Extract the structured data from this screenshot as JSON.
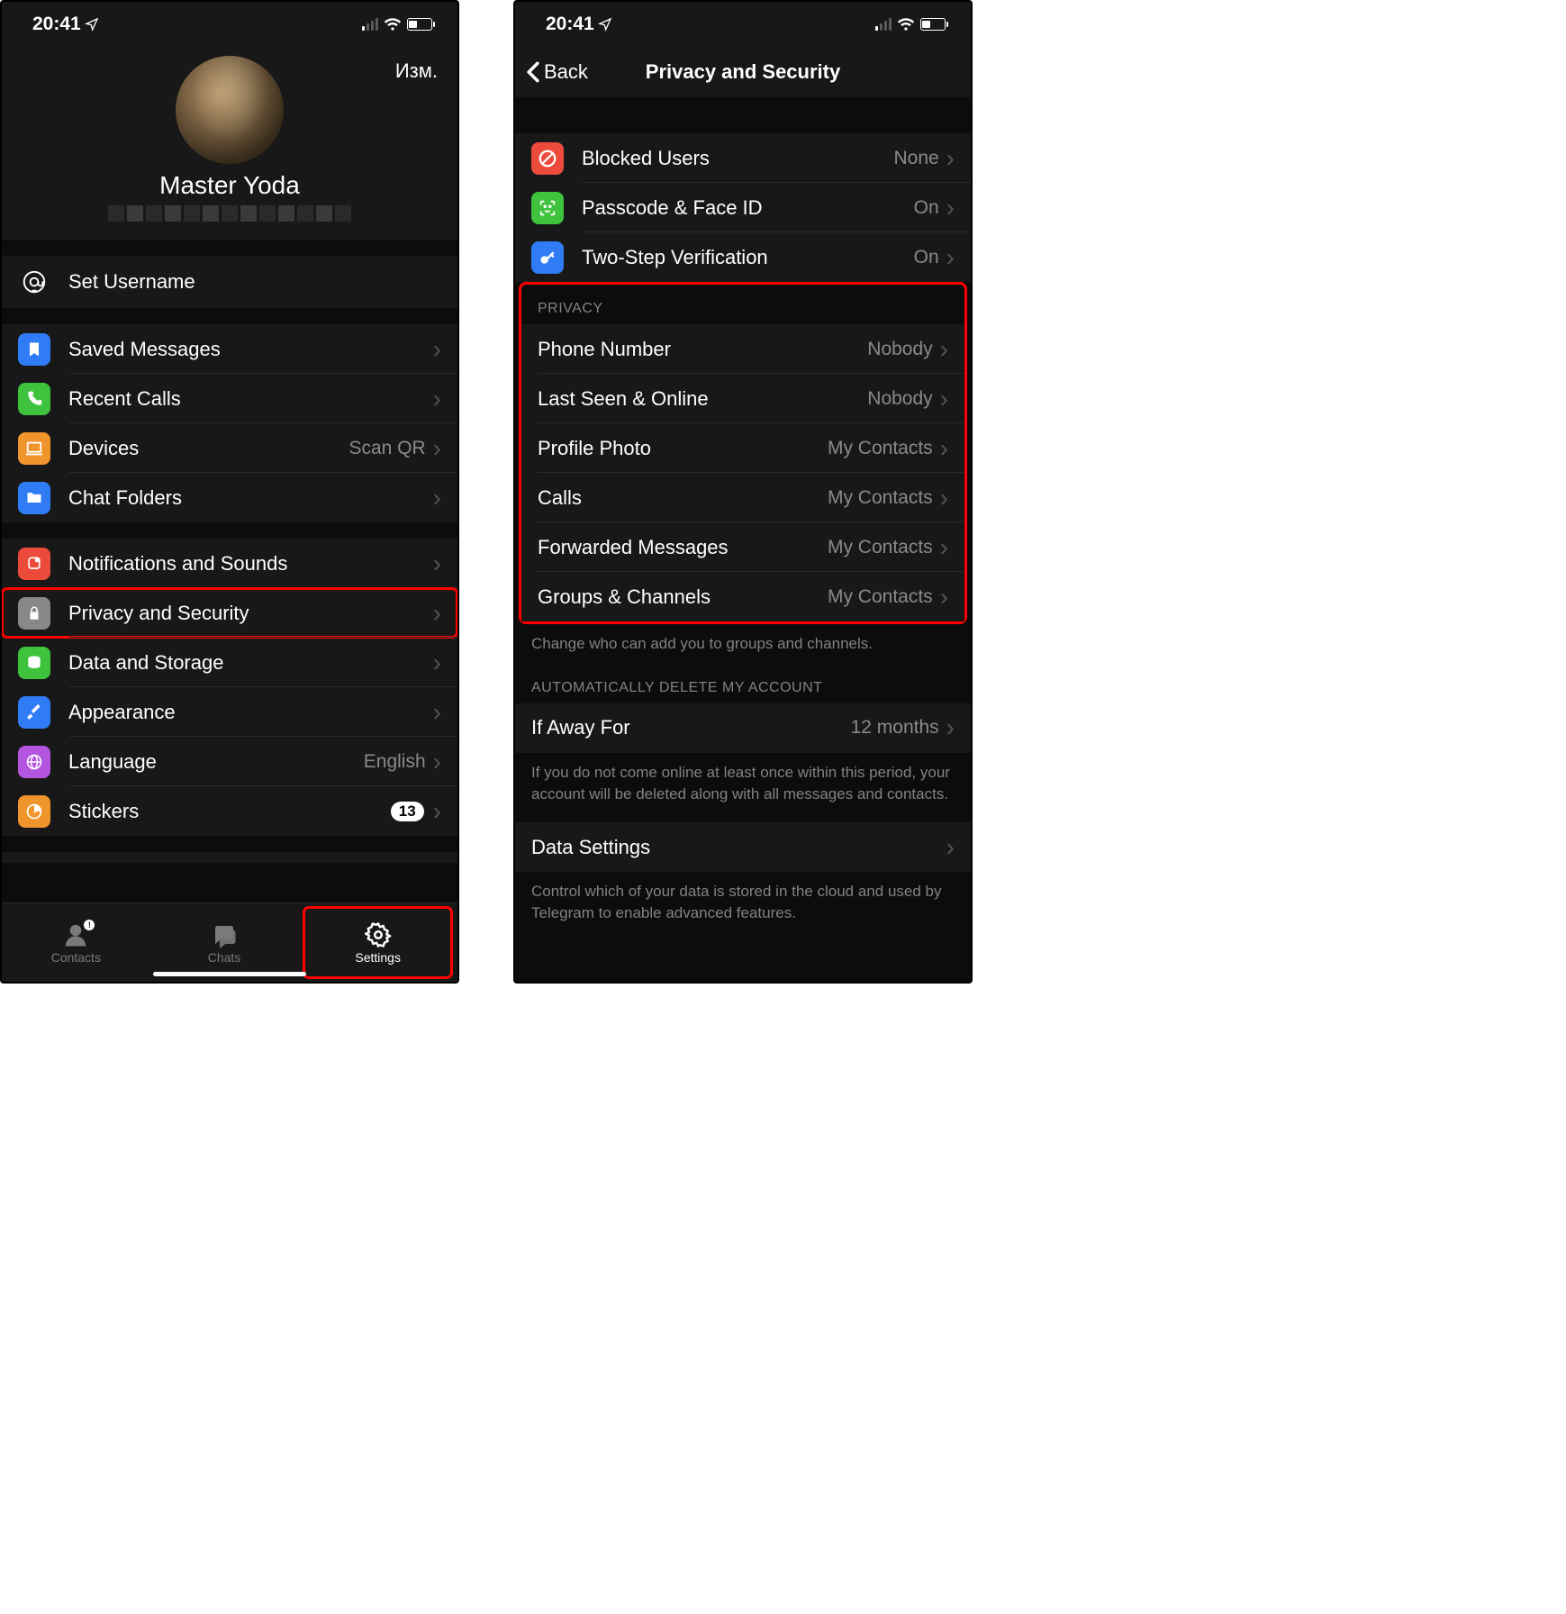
{
  "status": {
    "time": "20:41"
  },
  "left": {
    "edit": "Изм.",
    "profile_name": "Master Yoda",
    "username": {
      "label": "Set Username"
    },
    "section1": {
      "saved_messages": "Saved Messages",
      "recent_calls": "Recent Calls",
      "devices": "Devices",
      "devices_value": "Scan QR",
      "chat_folders": "Chat Folders"
    },
    "section2": {
      "notifications": "Notifications and Sounds",
      "privacy": "Privacy and Security",
      "data_storage": "Data and Storage",
      "appearance": "Appearance",
      "language": "Language",
      "language_value": "English",
      "stickers": "Stickers",
      "stickers_badge": "13"
    },
    "tabs": {
      "contacts": "Contacts",
      "chats": "Chats",
      "settings": "Settings"
    }
  },
  "right": {
    "back": "Back",
    "title": "Privacy and Security",
    "security": {
      "blocked": "Blocked Users",
      "blocked_value": "None",
      "passcode": "Passcode & Face ID",
      "passcode_value": "On",
      "two_step": "Two-Step Verification",
      "two_step_value": "On"
    },
    "privacy_header": "PRIVACY",
    "privacy": {
      "phone": "Phone Number",
      "phone_value": "Nobody",
      "last_seen": "Last Seen & Online",
      "last_seen_value": "Nobody",
      "profile_photo": "Profile Photo",
      "profile_photo_value": "My Contacts",
      "calls": "Calls",
      "calls_value": "My Contacts",
      "forwarded": "Forwarded Messages",
      "forwarded_value": "My Contacts",
      "groups": "Groups & Channels",
      "groups_value": "My Contacts"
    },
    "privacy_footer": "Change who can add you to groups and channels.",
    "auto_delete_header": "AUTOMATICALLY DELETE MY ACCOUNT",
    "auto_delete": {
      "if_away": "If Away For",
      "if_away_value": "12 months"
    },
    "auto_delete_footer": "If you do not come online at least once within this period, your account will be deleted along with all messages and contacts.",
    "data_settings": "Data Settings",
    "data_settings_footer": "Control which of your data is stored in the cloud and used by Telegram to enable advanced features."
  }
}
